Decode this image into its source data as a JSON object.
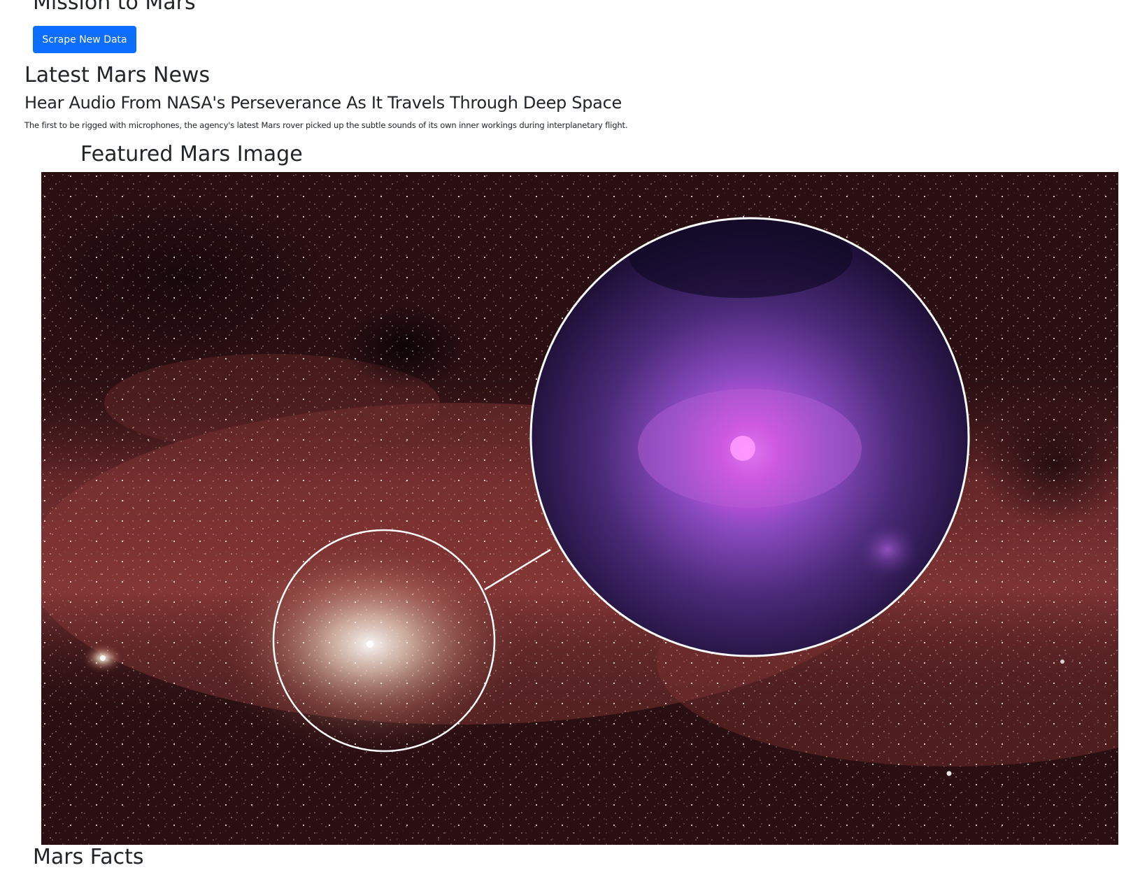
{
  "header": {
    "title": "Mission to Mars",
    "scrape_button_label": "Scrape New Data"
  },
  "news": {
    "section_heading": "Latest Mars News",
    "title": "Hear Audio From NASA's Perseverance As It Travels Through Deep Space",
    "teaser": "The first to be rigged with microphones, the agency's latest Mars rover picked up the subtle sounds of its own inner workings during interplanetary flight."
  },
  "featured_image": {
    "section_heading": "Featured Mars Image"
  },
  "facts": {
    "section_heading": "Mars Facts"
  },
  "colors": {
    "primary_button": "#0d6efd",
    "text": "#212529",
    "sky_base": "#2a0f12",
    "nebula_red": "#8a3a38",
    "inset_purple": "#6b3a9e",
    "inset_core": "#ff66ff"
  }
}
